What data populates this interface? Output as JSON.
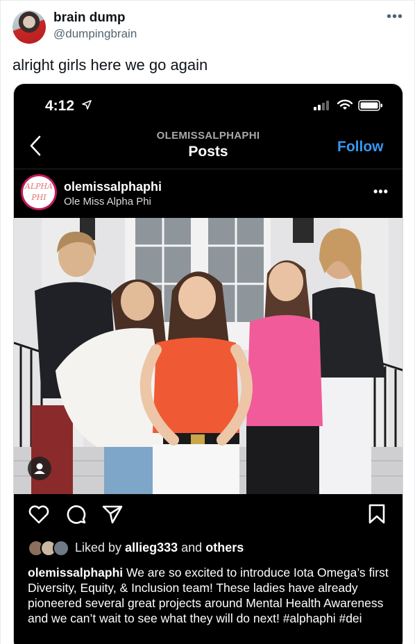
{
  "tweet": {
    "display_name": "brain dump",
    "handle": "@dumpingbrain",
    "text": "alright girls here we go again",
    "more": "•••"
  },
  "phone": {
    "status_time": "4:12",
    "nav_account": "OLEMISSALPHAPHI",
    "nav_title": "Posts",
    "follow_label": "Follow"
  },
  "post": {
    "avatar_logo_top": "ALPHA",
    "avatar_logo_bottom": "PHI",
    "username": "olemissalphaphi",
    "full_name": "Ole Miss Alpha Phi",
    "more": "•••",
    "likes_prefix": "Liked by",
    "likes_user": "allieg333",
    "likes_mid": "and",
    "likes_others": "others",
    "caption_user": "olemissalphaphi",
    "caption_text": "We are so excited to introduce Iota Omega’s first Diversity, Equity, & Inclusion team! These ladies have already pioneered several great projects around Mental Health Awareness and we can’t wait to see what they will do next! #alphaphi #dei"
  },
  "colors": {
    "follow": "#3897f0",
    "ig_background": "#000000",
    "handle_gray": "#536471"
  },
  "icons": [
    "location-arrow-icon",
    "cell-signal-icon",
    "wifi-icon",
    "battery-icon",
    "back-chevron-icon",
    "heart-icon",
    "comment-icon",
    "share-icon",
    "bookmark-icon",
    "user-tag-icon"
  ]
}
